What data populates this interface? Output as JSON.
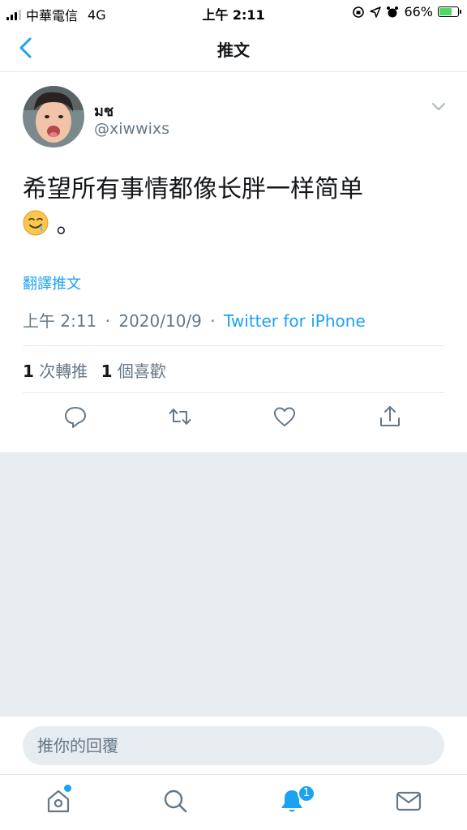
{
  "status_bar": {
    "carrier": "中華電信",
    "network": "4G",
    "time": "上午 2:11",
    "battery": "66%",
    "battery_level": 0.66
  },
  "nav": {
    "title": "推文",
    "back_icon": "chevron-left-icon"
  },
  "tweet": {
    "display_name": "มช",
    "handle": "@xiwwixs",
    "text": "希望所有事情都像长胖一样简单",
    "text_tail": " 。",
    "emoji_icon": "drooling-face-emoji",
    "translate_label": "翻譯推文",
    "time": "上午 2:11",
    "date": "2020/10/9",
    "separator": "·",
    "source": "Twitter for iPhone",
    "retweets_count": "1",
    "retweets_label": "次轉推",
    "likes_count": "1",
    "likes_label": "個喜歡"
  },
  "actions": [
    "reply-icon",
    "retweet-icon",
    "like-icon",
    "share-icon"
  ],
  "reply": {
    "placeholder": "推你的回覆"
  },
  "tabs": {
    "items": [
      "home-icon",
      "search-icon",
      "notifications-icon",
      "messages-icon"
    ],
    "notifications_badge": "1"
  },
  "colors": {
    "accent": "#1da1f2",
    "secondary_text": "#657786",
    "background_gray": "#e6ecf0"
  }
}
